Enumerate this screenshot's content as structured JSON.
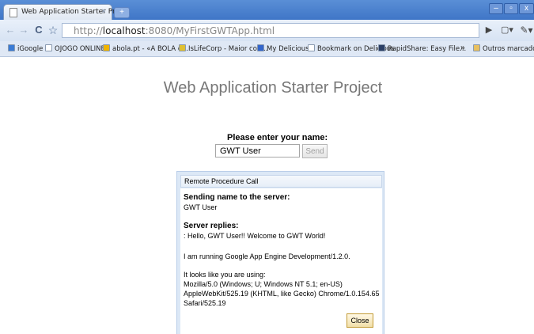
{
  "window": {
    "tab_title": "Web Application Starter Pr...",
    "tab_close": "×",
    "new_tab": "+",
    "controls": {
      "minimize": "–",
      "maximize": "▫",
      "close": "x"
    }
  },
  "toolbar": {
    "back": "←",
    "forward": "→",
    "reload": "C",
    "star": "☆",
    "url_prefix": "http://",
    "url_host": "localhost",
    "url_rest": ":8080/MyFirstGWTApp.html",
    "play": "▶",
    "page_menu": "▢▾",
    "wrench_menu": "✎▾"
  },
  "bookmarks": [
    {
      "label": "iGoogle",
      "color": "#3a7bd5"
    },
    {
      "label": "OJOGO ONLINE",
      "color": "#ffffff"
    },
    {
      "label": "abola.pt - «A BOLA o...",
      "color": "#f0b400"
    },
    {
      "label": "IsLifeCorp - Maior con...",
      "color": "#e0c030"
    },
    {
      "label": "My Delicious",
      "color": "#3366cc"
    },
    {
      "label": "Bookmark on Delicious",
      "color": "#ffffff"
    },
    {
      "label": "RapidShare: Easy File...",
      "color": "#2b3f66"
    },
    {
      "label": "Outros marcadores",
      "color": "#e8c060"
    }
  ],
  "bookmarks_more": "»",
  "page": {
    "title": "Web Application Starter Project",
    "name_label": "Please enter your name:",
    "name_value": "GWT User",
    "send_label": "Send"
  },
  "dialog": {
    "caption": "Remote Procedure Call",
    "sending_heading": "Sending name to the server:",
    "sending_value": "GWT User",
    "replies_heading": "Server replies:",
    "reply_line": ": Hello, GWT User!! Welcome to GWT World!",
    "engine_line": "I am running Google App Engine Development/1.2.0.",
    "ua_intro": "It looks like you are using:",
    "ua_line1": "Mozilla/5.0 (Windows; U; Windows NT 5.1; en-US)",
    "ua_line2": "AppleWebKit/525.19 (KHTML, like Gecko) Chrome/1.0.154.65",
    "ua_line3": "Safari/525.19",
    "close_label": "Close"
  }
}
